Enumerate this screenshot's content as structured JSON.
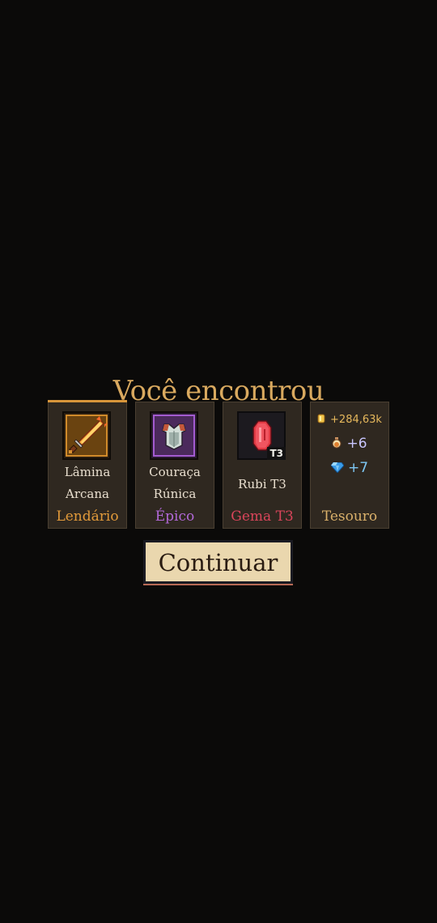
{
  "header": {
    "title": "Você encontrou"
  },
  "rewards": [
    {
      "name_line1": "Lâmina",
      "name_line2": "Arcana",
      "rarity": "Lendário",
      "rarity_color": "#e29a3a",
      "icon": "flaming-sword-icon"
    },
    {
      "name_line1": "Couraça",
      "name_line2": "Rúnica",
      "rarity": "Épico",
      "rarity_color": "#b268d8",
      "icon": "chest-armor-icon"
    },
    {
      "name": "Rubi T3",
      "rarity": "Gema T3",
      "rarity_color": "#d9455a",
      "icon": "ruby-gem-icon",
      "tier_badge": "T3"
    },
    {
      "rarity": "Tesouro",
      "rarity_color": "#d9b06a",
      "gold": {
        "icon": "gold-coin-icon",
        "value": "+284,63k",
        "color": "#e6b85c"
      },
      "potion": {
        "icon": "potion-icon",
        "value": "+6",
        "color": "#c9c6ff"
      },
      "diamond": {
        "icon": "diamond-icon",
        "value": "+7",
        "color": "#7ec8f5"
      }
    }
  ],
  "actions": {
    "continue_label": "Continuar"
  }
}
